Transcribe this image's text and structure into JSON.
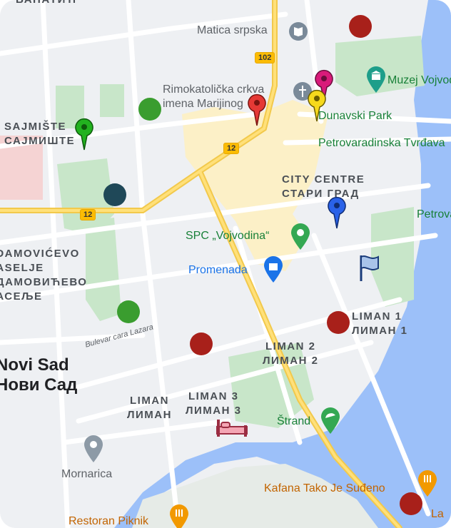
{
  "map": {
    "districts": [
      {
        "key": "banatic",
        "lines": [
          "БАНАТИЋ"
        ]
      },
      {
        "key": "sajmiste",
        "lines": [
          "SAJMIŠTE",
          "САЈМИШТЕ"
        ]
      },
      {
        "key": "city_centre",
        "lines": [
          "CITY CENTRE",
          "СТАРИ ГРАД"
        ]
      },
      {
        "key": "adamovicevo",
        "lines": [
          "ADAMOVIĆEVO",
          "NASELJE",
          "АДАМОВИЋЕВО",
          "НАСЕЉЕ"
        ]
      },
      {
        "key": "liman1",
        "lines": [
          "LIMAN 1",
          "ЛИМАН 1"
        ]
      },
      {
        "key": "liman2",
        "lines": [
          "LIMAN 2",
          "ЛИМАН 2"
        ]
      },
      {
        "key": "liman3",
        "lines": [
          "LIMAN 3",
          "ЛИМАН 3"
        ]
      },
      {
        "key": "liman",
        "lines": [
          "LIMAN",
          "ЛИМАН"
        ]
      }
    ],
    "city": {
      "latin": "Novi Sad",
      "cyrillic": "Нови Сад"
    },
    "pois": {
      "matica": "Matica srpska",
      "church": "Rimokatolička crkva imena Marijinog",
      "muzej": "Muzej Vojvodine",
      "dunavski_park": "Dunavski Park",
      "petrovaradinska": "Petrovaradinska Tvrđava",
      "petro": "Petrovaradin",
      "spc": "SPC „Vojvodina“",
      "promenada": "Promenada",
      "strand": "Štrand",
      "mornarica": "Mornarica",
      "kafana": "Kafana Tako Je Suđeno",
      "piknik": "Restoran Piknik",
      "la": "La"
    },
    "roads": {
      "bulevar": "Bulevar cara Lazara"
    },
    "shields": {
      "r102": "102",
      "r12a": "12",
      "r12b": "12"
    },
    "marker_colors": {
      "red": "#a8201a",
      "green": "#3a9d2f",
      "navy": "#1f4858",
      "pin_red": "#e53935",
      "pin_magenta": "#d81b7a",
      "pin_yellow": "#f6d91c",
      "pin_green": "#22b21f",
      "pin_blue": "#2a62e8"
    },
    "icons": [
      "book-icon",
      "church-icon",
      "museum-icon",
      "landmark-pin-icon",
      "shopping-icon",
      "beach-icon",
      "restaurant-icon",
      "flag-icon",
      "bed-icon"
    ]
  }
}
